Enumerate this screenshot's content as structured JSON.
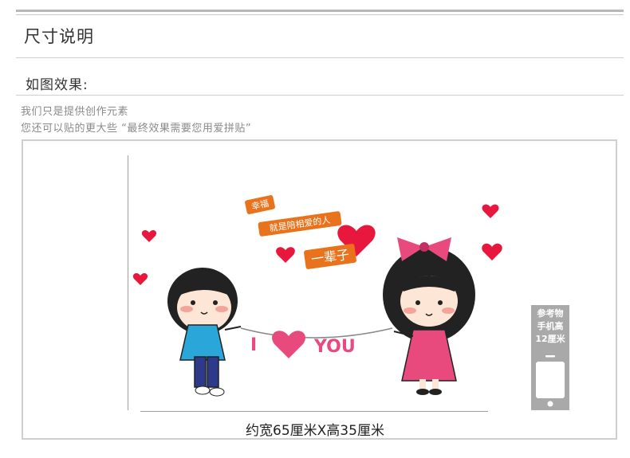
{
  "header": {
    "title": "尺寸说明"
  },
  "effect": {
    "label": "如图效果:"
  },
  "notes": [
    "我们只是提供创作元素",
    "您还可以贴的更大些    “最终效果需要您用爱拼贴”"
  ],
  "artwork": {
    "tag1": "幸福",
    "tag2": "就是陪相爱的人",
    "tag3": "一辈子",
    "banner_i": "I",
    "banner_you": "YOU"
  },
  "size": {
    "label": "约宽65厘米X高35厘米"
  },
  "reference": {
    "lines": [
      "参考物",
      "手机高",
      "12厘米"
    ]
  },
  "colors": {
    "orange": "#e8731c",
    "pink": "#e84a7e",
    "red": "#e8173d",
    "blue": "#2aa6d8"
  }
}
